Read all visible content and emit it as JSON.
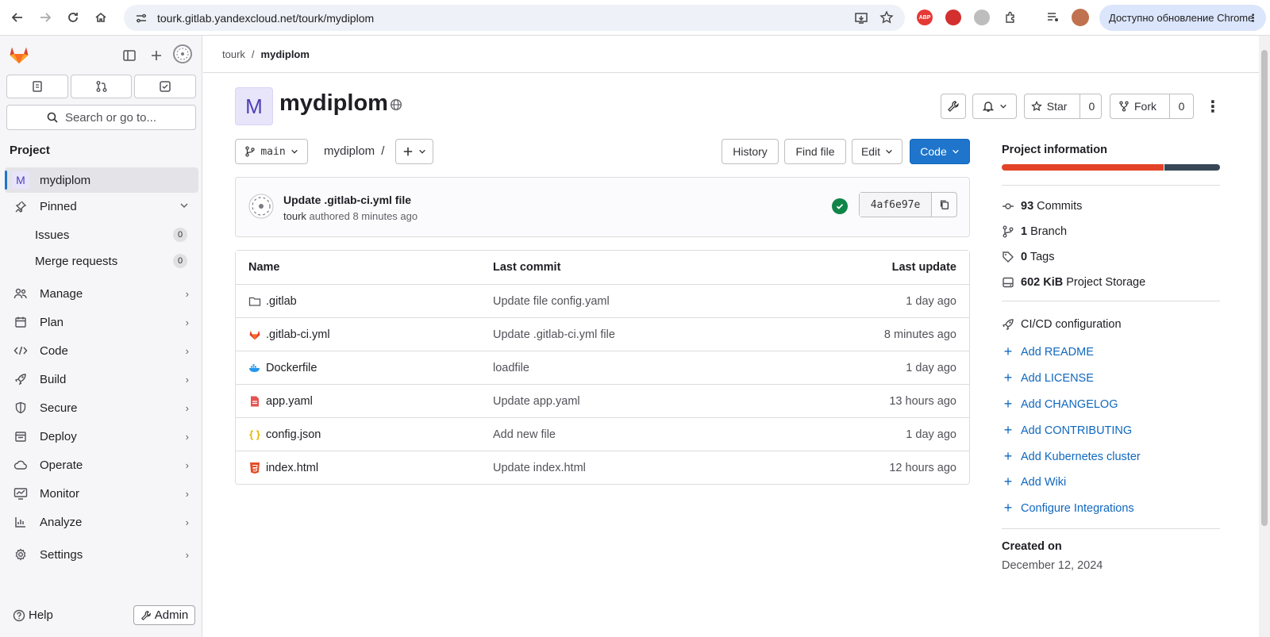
{
  "browser": {
    "url_host": "tourk.gitlab.yandexcloud.net",
    "url_path": "/tourk/mydiplom",
    "update_label": "Доступно обновление Chrome"
  },
  "sidebar": {
    "search_placeholder": "Search or go to...",
    "section_label": "Project",
    "project_item": "mydiplom",
    "project_initial": "M",
    "pinned_label": "Pinned",
    "pinned": [
      {
        "label": "Issues",
        "count": "0"
      },
      {
        "label": "Merge requests",
        "count": "0"
      }
    ],
    "menu": [
      {
        "label": "Manage",
        "icon": "users-icon"
      },
      {
        "label": "Plan",
        "icon": "calendar-icon"
      },
      {
        "label": "Code",
        "icon": "code-icon"
      },
      {
        "label": "Build",
        "icon": "rocket-icon"
      },
      {
        "label": "Secure",
        "icon": "shield-icon"
      },
      {
        "label": "Deploy",
        "icon": "deployments-icon"
      },
      {
        "label": "Operate",
        "icon": "cloud-gear-icon"
      },
      {
        "label": "Monitor",
        "icon": "monitor-icon"
      },
      {
        "label": "Analyze",
        "icon": "chart-icon"
      },
      {
        "label": "Settings",
        "icon": "gear-icon"
      }
    ],
    "help_label": "Help",
    "admin_label": "Admin"
  },
  "breadcrumb": {
    "parent": "tourk",
    "separator": "/",
    "current": "mydiplom"
  },
  "project": {
    "initial": "M",
    "name": "mydiplom",
    "star_label": "Star",
    "star_count": "0",
    "fork_label": "Fork",
    "fork_count": "0"
  },
  "toolbar": {
    "branch": "main",
    "path": "mydiplom",
    "path_sep": "/",
    "history": "History",
    "find_file": "Find file",
    "edit": "Edit",
    "code": "Code"
  },
  "last_commit": {
    "title": "Update .gitlab-ci.yml file",
    "author": "tourk",
    "meta": " authored 8 minutes ago",
    "sha": "4af6e97e"
  },
  "files": {
    "headers": {
      "name": "Name",
      "commit": "Last commit",
      "update": "Last update"
    },
    "rows": [
      {
        "name": ".gitlab",
        "commit": "Update file config.yaml",
        "update": "1 day ago",
        "icon": "folder-icon"
      },
      {
        "name": ".gitlab-ci.yml",
        "commit": "Update .gitlab-ci.yml file",
        "update": "8 minutes ago",
        "icon": "gitlab-file-icon"
      },
      {
        "name": "Dockerfile",
        "commit": "loadfile",
        "update": "1 day ago",
        "icon": "docker-icon"
      },
      {
        "name": "app.yaml",
        "commit": "Update app.yaml",
        "update": "13 hours ago",
        "icon": "yaml-icon"
      },
      {
        "name": "config.json",
        "commit": "Add new file",
        "update": "1 day ago",
        "icon": "json-icon"
      },
      {
        "name": "index.html",
        "commit": "Update index.html",
        "update": "12 hours ago",
        "icon": "html-icon"
      }
    ]
  },
  "info": {
    "title": "Project information",
    "stats": [
      {
        "value": "93",
        "label": "Commits"
      },
      {
        "value": "1",
        "label": "Branch"
      },
      {
        "value": "0",
        "label": "Tags"
      },
      {
        "value": "602 KiB",
        "label": "Project Storage"
      }
    ],
    "cicd": "CI/CD configuration",
    "links": [
      "Add README",
      "Add LICENSE",
      "Add CHANGELOG",
      "Add CONTRIBUTING",
      "Add Kubernetes cluster",
      "Add Wiki",
      "Configure Integrations"
    ],
    "created_label": "Created on",
    "created_value": "December 12, 2024"
  },
  "colors": {
    "accent": "#1f75cb",
    "lang_primary": "#e24329",
    "lang_secondary": "#384756",
    "success": "#108548"
  }
}
